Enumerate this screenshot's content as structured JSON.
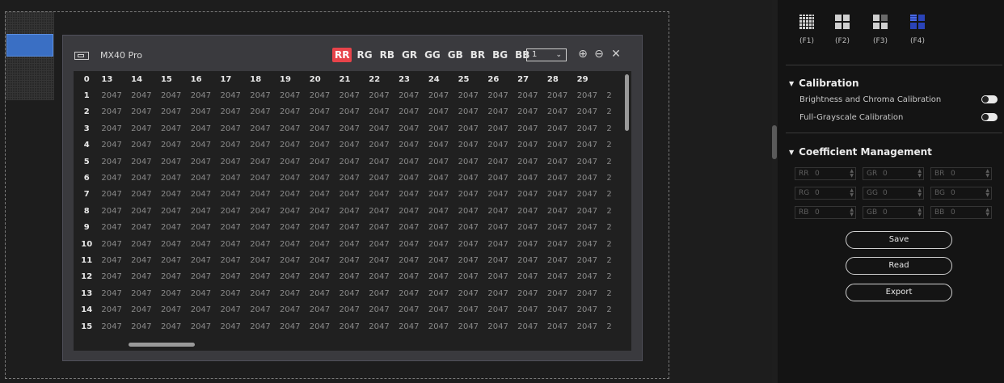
{
  "dialog": {
    "title": "MX40 Pro",
    "coefficient_tabs": [
      "RR",
      "RG",
      "RB",
      "GR",
      "GG",
      "GB",
      "BR",
      "BG",
      "BB"
    ],
    "active_tab": "RR",
    "page_select": "1",
    "grid": {
      "corner": "0",
      "column_headers": [
        "13",
        "14",
        "15",
        "16",
        "17",
        "18",
        "19",
        "20",
        "21",
        "22",
        "23",
        "24",
        "25",
        "26",
        "27",
        "28",
        "29"
      ],
      "row_headers": [
        "1",
        "2",
        "3",
        "4",
        "5",
        "6",
        "7",
        "8",
        "9",
        "10",
        "11",
        "12",
        "13",
        "14",
        "15"
      ],
      "cell_value": "2047",
      "partial_column_text": "2"
    }
  },
  "panel": {
    "modes": [
      {
        "label": "(F1)",
        "icon": "grid-fine-icon"
      },
      {
        "label": "(F2)",
        "icon": "grid-four-icon"
      },
      {
        "label": "(F3)",
        "icon": "grid-partial-icon"
      },
      {
        "label": "(F4)",
        "icon": "grid-blue-icon"
      }
    ],
    "calibration": {
      "title": "Calibration",
      "options": [
        {
          "label": "Brightness and Chroma Calibration",
          "on": false
        },
        {
          "label": "Full-Grayscale Calibration",
          "on": false
        }
      ]
    },
    "coefficient_management": {
      "title": "Coefficient Management",
      "fields": [
        {
          "key": "RR",
          "value": "0"
        },
        {
          "key": "GR",
          "value": "0"
        },
        {
          "key": "BR",
          "value": "0"
        },
        {
          "key": "RG",
          "value": "0"
        },
        {
          "key": "GG",
          "value": "0"
        },
        {
          "key": "BG",
          "value": "0"
        },
        {
          "key": "RB",
          "value": "0"
        },
        {
          "key": "GB",
          "value": "0"
        },
        {
          "key": "BB",
          "value": "0"
        }
      ],
      "buttons": {
        "save": "Save",
        "read": "Read",
        "export": "Export"
      }
    }
  },
  "colors": {
    "active_tab": "#e8434a",
    "selected_cabinet": "#3a6fc4",
    "f4_icon": "#2a43b8"
  }
}
